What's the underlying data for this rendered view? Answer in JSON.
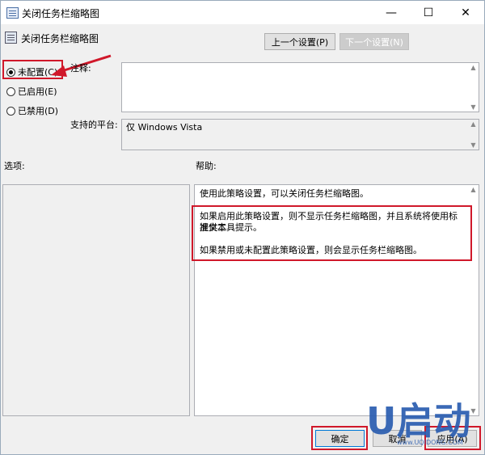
{
  "window": {
    "title": "关闭任务栏缩略图"
  },
  "titlebar_buttons": {
    "minimize": "—",
    "maximize": "☐",
    "close": "✕"
  },
  "policy": {
    "title": "关闭任务栏缩略图"
  },
  "nav": {
    "prev": "上一个设置(P)",
    "next": "下一个设置(N)"
  },
  "state_options": [
    {
      "label": "未配置(C)",
      "checked": true
    },
    {
      "label": "已启用(E)",
      "checked": false
    },
    {
      "label": "已禁用(D)",
      "checked": false
    }
  ],
  "comment": {
    "label": "注释:",
    "value": ""
  },
  "platform": {
    "label": "支持的平台:",
    "value": "仅 Windows Vista"
  },
  "options": {
    "label": "选项:"
  },
  "help": {
    "label": "帮助:",
    "p1": "使用此策略设置，可以关闭任务栏缩略图。",
    "p2a": "如果启用此策略设置，则不显示任务栏缩略图，并且系统将使用标准文本",
    "p2b": "提供工具提示。",
    "p3": "如果禁用或未配置此策略设置，则会显示任务栏缩略图。"
  },
  "footer": {
    "ok": "确定",
    "cancel": "取消",
    "apply": "应用(A)"
  },
  "watermark": {
    "brand": "U启动",
    "site": "www.UQIDONG.COM"
  },
  "colors": {
    "highlight_border": "#d0182a",
    "accent": "#2a5db0"
  }
}
